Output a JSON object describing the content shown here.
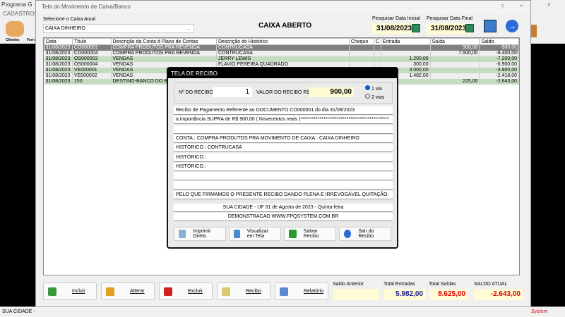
{
  "app": {
    "title": "Programa G",
    "menu": "CADASTROS",
    "icons": [
      "Clientes",
      "Forn"
    ],
    "status_left": "SUA CIDADE - ",
    "status_right": "System"
  },
  "window": {
    "title": "Tela do Movimento de Caixa/Banco",
    "help": "?",
    "close": "×"
  },
  "caixa": {
    "label": "Selecione o Caixa Atual",
    "value": "CAIXA DINHEIRO",
    "status": "CAIXA ABERTO"
  },
  "dates": {
    "start_label": "Pesquisar Data Inicial",
    "start": "31/08/2023",
    "end_label": "Pesquisar Data Final",
    "end": "31/08/2023"
  },
  "grid": {
    "columns": [
      "Data",
      "Título",
      "Descrição da Conta d Plano de Contas",
      "Descrição do Histórico",
      "Cheque",
      "C",
      "Entrada",
      "Saída",
      "Saldo"
    ],
    "rows": [
      [
        "31/08/2023",
        "CO000001",
        "COMPRA PRODUTOS PRA REVENDA",
        "CONTRUCASA",
        "",
        "",
        "",
        "900,00",
        "-900,00"
      ],
      [
        "31/08/2023",
        "CO000004",
        "COMPRA PRODUTOS PRA REVENDA",
        "CONTRUCASA",
        "",
        "",
        "",
        "7.500,00",
        "-8.400,00"
      ],
      [
        "31/08/2023",
        "OS000003",
        "VENDAS",
        "JERRY LEWIS",
        "",
        "",
        "1.200,00",
        "",
        "-7.200,00"
      ],
      [
        "31/08/2023",
        "OS000004",
        "VENDAS",
        "FLAVIO PEREIRA QUADRADO",
        "",
        "",
        "300,00",
        "",
        "-6.900,00"
      ],
      [
        "31/08/2023",
        "VE000001",
        "VENDAS",
        "",
        "",
        "",
        "3.000,00",
        "",
        "-3.900,00"
      ],
      [
        "31/08/2023",
        "VE000002",
        "VENDAS",
        "",
        "",
        "",
        "1.482,00",
        "",
        "-2.418,00"
      ],
      [
        "31/08/2023",
        "150",
        "DESTINO-BANCO DO BRA",
        "",
        "",
        "",
        "",
        "225,00",
        "-2.643,00"
      ]
    ]
  },
  "receipt": {
    "title": "TELA DE RECIBO",
    "num_label": "Nº DO RECIBO",
    "num": "1",
    "value_label": "VALOR DO RECIBO R$",
    "value": "900,00",
    "via1": "1 via",
    "via2": "2 vias",
    "lines": [
      "Recibo de Pagamento Referente ao DOCUMENTO CO000001     do dia 31/08/2023",
      "a importância SUPRA de R$       900,00 ( Novecentos reais )**********************************************",
      "",
      "CONTA.: COMPRA PRODUTOS PRA  MOVIMENTO DE CAIXA.: CAIXA DINHEIRO",
      "HISTÓRICO.: CONTRUCASA",
      "HISTÓRICO.:",
      "HISTÓRICO.:",
      "",
      "",
      "PELO QUE FIRMAMOS O PRESENTE RECIBO DANDO PLENA E IRREVOGÁVEL QUITAÇÃO."
    ],
    "city": "SUA CIDADE - UF 31 de Agosto de 2023 - Quinta-feira",
    "demo": "DEMONSTRACAO WWW.FPQSYSTEM.COM.BR",
    "buttons": [
      "Imprimir Direto",
      "Visualizar em Tela",
      "Salvar Recibo",
      "Sair do Recibo"
    ]
  },
  "actions": [
    "Incluir",
    "Alterar",
    "Excluir",
    "Recibo",
    "Relatório"
  ],
  "totals": {
    "anterior_label": "Saldo Anterior",
    "anterior": "",
    "entradas_label": "Total Entradas",
    "entradas": "5.982,00",
    "saidas_label": "Total Saídas",
    "saidas": "8.625,00",
    "atual_label": "SALDO ATUAL",
    "atual": "-2.643,00"
  }
}
